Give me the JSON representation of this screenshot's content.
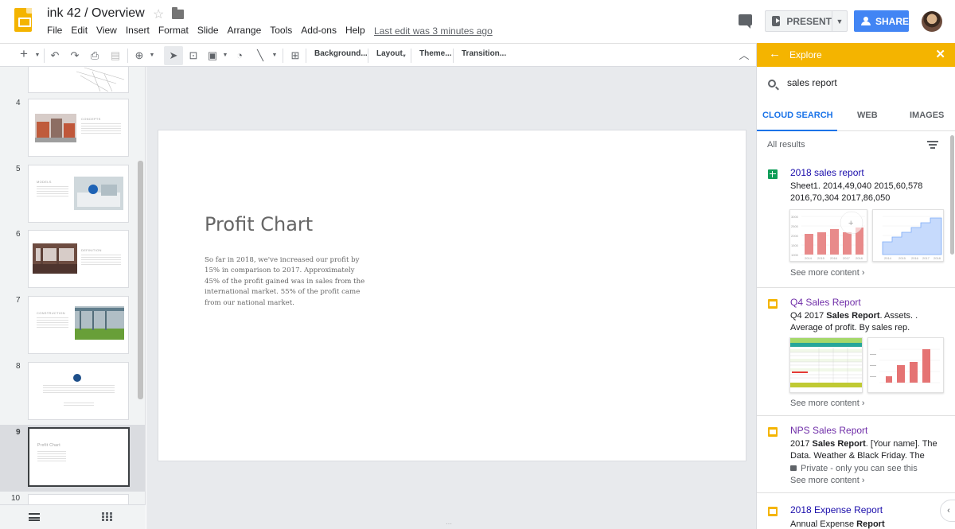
{
  "header": {
    "doc_title": "ink 42 / Overview",
    "menu": [
      "File",
      "Edit",
      "View",
      "Insert",
      "Format",
      "Slide",
      "Arrange",
      "Tools",
      "Add-ons",
      "Help"
    ],
    "last_edit": "Last edit was 3 minutes ago",
    "present_label": "PRESENT",
    "share_label": "SHARE"
  },
  "toolbar": {
    "background_label": "Background...",
    "layout_label": "Layout",
    "theme_label": "Theme...",
    "transition_label": "Transition..."
  },
  "filmstrip": {
    "slides": [
      {
        "num": "4",
        "title": "CONCEPTS"
      },
      {
        "num": "5",
        "title": "MODELS"
      },
      {
        "num": "6",
        "title": "DEFINITION"
      },
      {
        "num": "7",
        "title": "CONSTRUCTION"
      },
      {
        "num": "8",
        "title": ""
      },
      {
        "num": "9",
        "title": "Profit Chart"
      },
      {
        "num": "10",
        "title": ""
      }
    ],
    "selected": "9"
  },
  "slide": {
    "title": "Profit Chart",
    "body": "So far in 2018, we've increased our profit by 15% in comparison to 2017. Approximately 45% of the profit gained was in sales from the international market. 55% of the profit came from our national market."
  },
  "explore": {
    "title": "Explore",
    "query": "sales report",
    "tabs": [
      "CLOUD SEARCH",
      "WEB",
      "IMAGES"
    ],
    "results_heading": "All results",
    "see_more": "See more content",
    "results": [
      {
        "type": "sheets",
        "title": "2018 sales report",
        "snippet": "Sheet1. 2014,49,040 2015,60,578 2016,70,304 2017,86,050",
        "title_color": "#1a0dab"
      },
      {
        "type": "slides",
        "title": "Q4 Sales Report",
        "snippet_pre": "Q4 2017 ",
        "snippet_bold": "Sales Report",
        "snippet_post": ". Assets. . Average of profit. By sales rep.",
        "title_color": "#6f2da8"
      },
      {
        "type": "slides",
        "title": "NPS Sales Report",
        "snippet_pre": "2017 ",
        "snippet_bold": "Sales Report",
        "snippet_post": ". [Your name]. The Data. Weather & Black Friday. The",
        "private": "Private - only you can see this",
        "title_color": "#6f2da8"
      },
      {
        "type": "slides",
        "title": "2018 Expense Report",
        "snippet_pre": "Annual Expense ",
        "snippet_bold": "Report",
        "snippet_post": "",
        "title_color": "#1a0dab"
      }
    ],
    "colors": {
      "accent": "#f4b400",
      "link": "#1a73e8"
    }
  }
}
